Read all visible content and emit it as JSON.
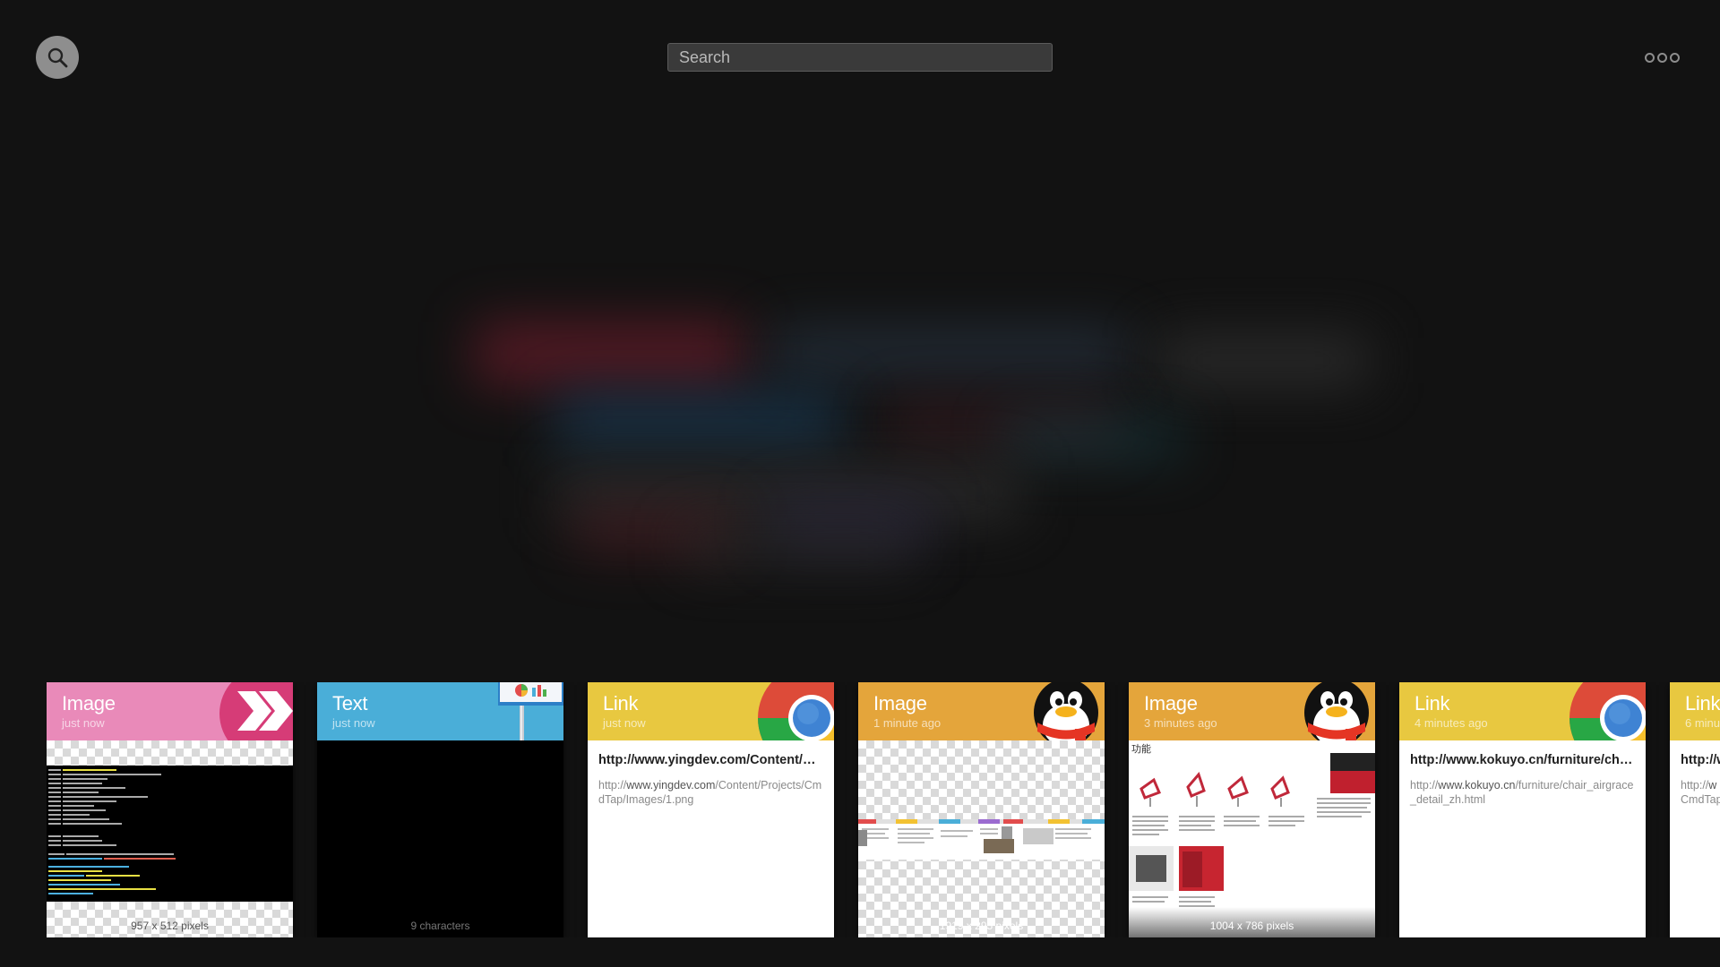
{
  "search": {
    "placeholder": "Search"
  },
  "colors": {
    "background": "#121212",
    "pink": "#e98ab9",
    "blue": "#4aaed8",
    "yellow": "#e8c840",
    "orange": "#e4a53b"
  },
  "clips": [
    {
      "type": "Image",
      "time": "just now",
      "caption": "957 x 512 pixels",
      "app_icon": "pink-arrow-app-icon"
    },
    {
      "type": "Text",
      "time": "just now",
      "caption": "9 characters",
      "app_icon": "keynote-icon"
    },
    {
      "type": "Link",
      "time": "just now",
      "title": "http://www.yingdev.com/Content/Pr...",
      "url_prefix": "http://",
      "url_host": "www.yingdev.com",
      "url_rest": "/Content/Projects/CmdTap/Images/1.png",
      "app_icon": "chrome-icon"
    },
    {
      "type": "Image",
      "time": "1 minute ago",
      "caption": "1919 x 295 pixels",
      "app_icon": "qq-penguin-icon"
    },
    {
      "type": "Image",
      "time": "3 minutes ago",
      "caption": "1004 x 786 pixels",
      "heading": "功能",
      "app_icon": "qq-penguin-icon"
    },
    {
      "type": "Link",
      "time": "4 minutes ago",
      "title": "http://www.kokuyo.cn/furniture/chai...",
      "url_prefix": "http://",
      "url_host": "www.kokuyo.cn",
      "url_rest": "/furniture/chair_airgrace_detail_zh.html",
      "app_icon": "chrome-icon"
    },
    {
      "type": "Link",
      "time": "6 minu",
      "title": "http://w",
      "url_prefix": "http://",
      "url_host": "w",
      "url_rest": "CmdTap",
      "app_icon": "chrome-icon"
    }
  ]
}
